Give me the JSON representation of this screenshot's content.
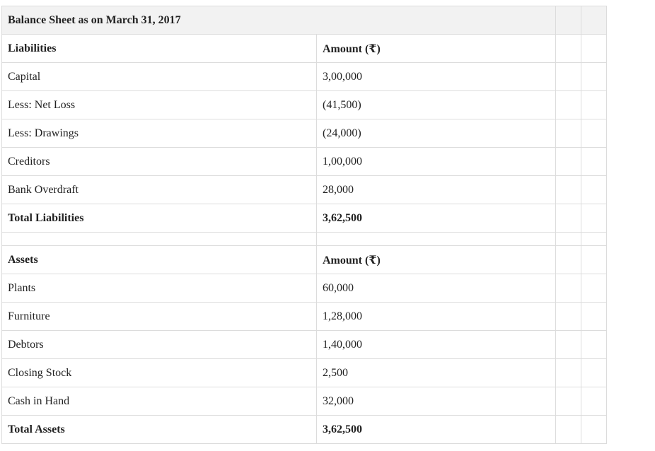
{
  "title": "Balance Sheet as on March 31, 2017",
  "liabilities": {
    "header": [
      "Liabilities",
      "Amount (₹)"
    ],
    "rows": [
      [
        "Capital",
        "3,00,000"
      ],
      [
        "Less: Net Loss",
        "(41,500)"
      ],
      [
        "Less: Drawings",
        "(24,000)"
      ],
      [
        "Creditors",
        "1,00,000"
      ],
      [
        "Bank Overdraft",
        "28,000"
      ]
    ],
    "total": [
      "Total Liabilities",
      "3,62,500"
    ]
  },
  "assets": {
    "header": [
      "Assets",
      "Amount (₹)"
    ],
    "rows": [
      [
        "Plants",
        "60,000"
      ],
      [
        "Furniture",
        "1,28,000"
      ],
      [
        "Debtors",
        "1,40,000"
      ],
      [
        "Closing Stock",
        "2,500"
      ],
      [
        "Cash in Hand",
        "32,000"
      ]
    ],
    "total": [
      "Total Assets",
      "3,62,500"
    ]
  }
}
